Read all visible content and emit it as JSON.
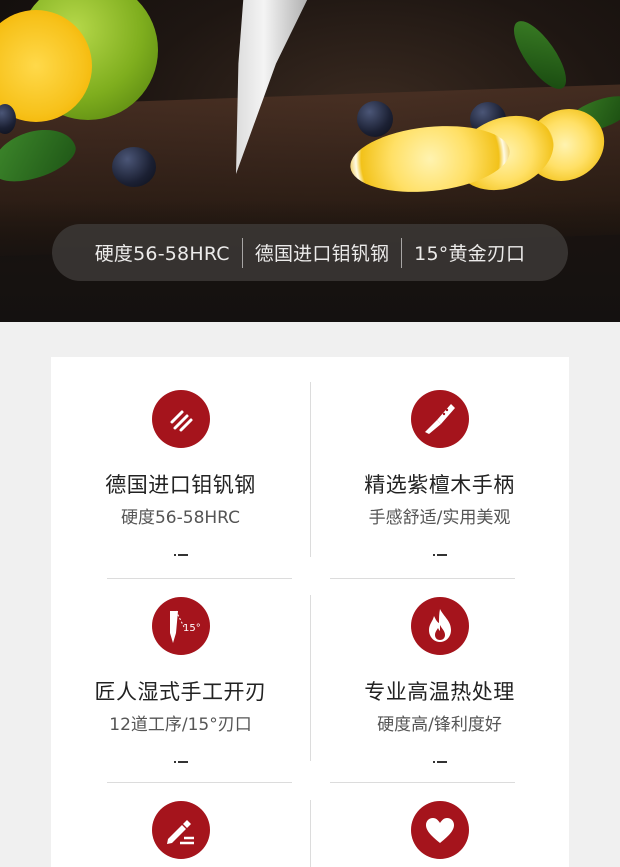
{
  "hero": {
    "specs": [
      "硬度56-58HRC",
      "德国进口钼钒钢",
      "15°黄金刃口"
    ]
  },
  "features": [
    {
      "icon": "diagonal-lines-icon",
      "title": "德国进口钼钒钢",
      "subtitle": "硬度56-58HRC"
    },
    {
      "icon": "knife-icon",
      "title": "精选紫檀木手柄",
      "subtitle": "手感舒适/实用美观"
    },
    {
      "icon": "blade-angle-icon",
      "icon_text": "15°",
      "title": "匠人湿式手工开刃",
      "subtitle": "12道工序/15°刃口"
    },
    {
      "icon": "flame-icon",
      "title": "专业高温热处理",
      "subtitle": "硬度高/锋利度好"
    },
    {
      "icon": "pencil-edit-icon",
      "title": "",
      "subtitle": ""
    },
    {
      "icon": "heart-icon",
      "title": "",
      "subtitle": ""
    }
  ],
  "colors": {
    "accent": "#a5141c",
    "spec_bar": "#3c3836",
    "card": "#ffffff",
    "page": "#f0f0f0"
  }
}
